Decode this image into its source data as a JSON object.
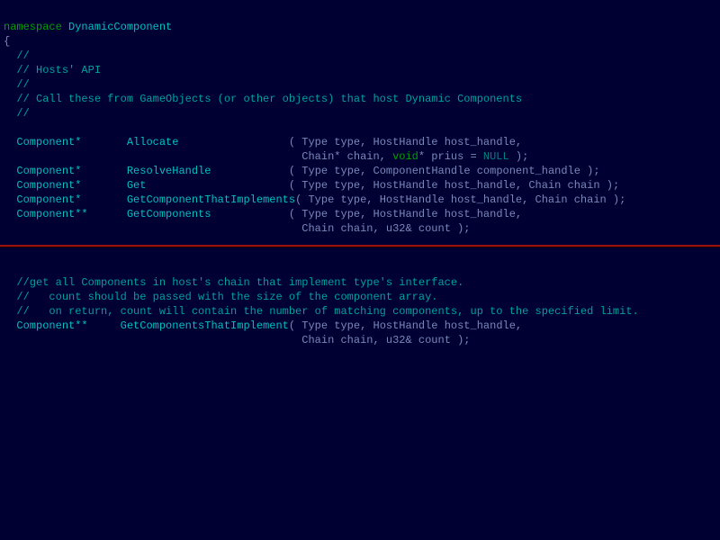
{
  "kw_namespace": "namespace",
  "ns_name": "DynamicComponent",
  "brace_open": "{",
  "c1": "//",
  "c2": "// Hosts' API",
  "c3": "//",
  "c4": "// Call these from GameObjects (or other objects) that host Dynamic Components",
  "c5": "//",
  "ret_Component_ptr": "Component*",
  "ret_Component_dptr": "Component**",
  "fn_Allocate": "Allocate",
  "fn_ResolveHandle": "ResolveHandle",
  "fn_Get": "Get",
  "fn_GetComponentThatImplements": "GetComponentThatImplements",
  "fn_GetComponents": "GetComponents",
  "fn_GetComponentsThatImplement": "GetComponentsThatImplement",
  "sig_Allocate_l1": "( Type type, HostHandle host_handle,",
  "sig_Allocate_l2a": "  Chain* chain, ",
  "kw_void": "void",
  "sig_Allocate_l2b": "* prius = ",
  "lit_NULL": "NULL",
  "sig_Allocate_l2c": " );",
  "sig_ResolveHandle": "( Type type, ComponentHandle component_handle );",
  "sig_Get": "( Type type, HostHandle host_handle, Chain chain );",
  "sig_GetComponentThatImplements": "( Type type, HostHandle host_handle, Chain chain );",
  "sig_GetComponents_l1": "( Type type, HostHandle host_handle,",
  "sig_GetComponents_l2": "  Chain chain, u32& count );",
  "c6": "//get all Components in host's chain that implement type's interface.",
  "c7": "//   count should be passed with the size of the component array.",
  "c8": "//   on return, count will contain the number of matching components, up to the specified limit.",
  "sig_GetComponentsTI_l1": "( Type type, HostHandle host_handle,",
  "sig_GetComponentsTI_l2": "  Chain chain, u32& count );"
}
